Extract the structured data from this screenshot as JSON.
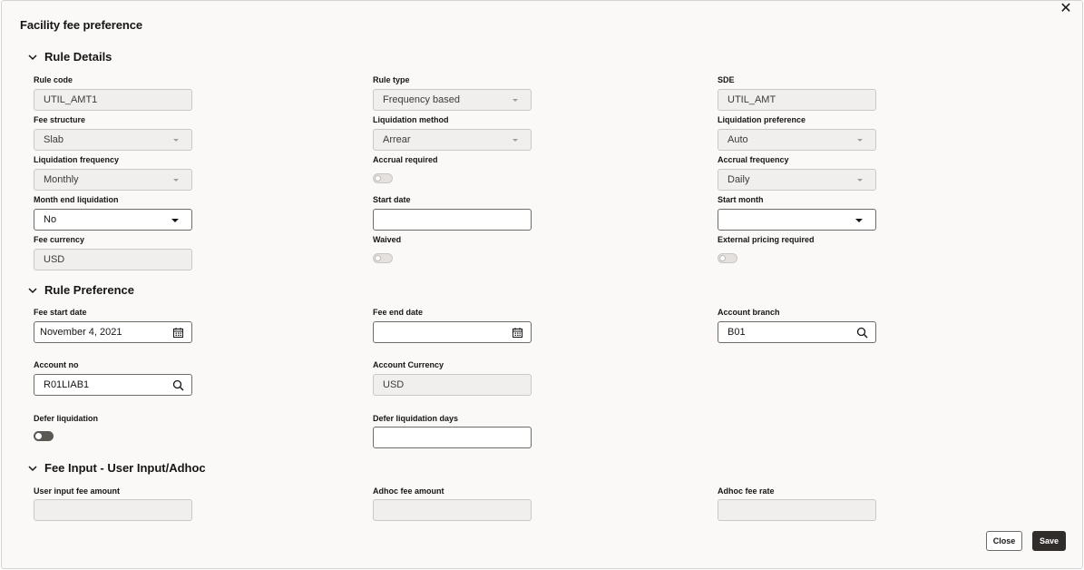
{
  "dialog": {
    "title": "Facility fee preference",
    "close_icon": "close-icon"
  },
  "rule_details": {
    "title": "Rule Details",
    "rule_code": {
      "label": "Rule code",
      "value": "UTIL_AMT1"
    },
    "rule_type": {
      "label": "Rule type",
      "value": "Frequency based"
    },
    "sde": {
      "label": "SDE",
      "value": "UTIL_AMT"
    },
    "fee_structure": {
      "label": "Fee structure",
      "value": "Slab"
    },
    "liquidation_method": {
      "label": "Liquidation method",
      "value": "Arrear"
    },
    "liquidation_preference": {
      "label": "Liquidation preference",
      "value": "Auto"
    },
    "liquidation_frequency": {
      "label": "Liquidation frequency",
      "value": "Monthly"
    },
    "accrual_required": {
      "label": "Accrual required",
      "on": false
    },
    "accrual_frequency": {
      "label": "Accrual frequency",
      "value": "Daily"
    },
    "month_end_liquidation": {
      "label": "Month end liquidation",
      "value": "No"
    },
    "start_date": {
      "label": "Start date",
      "value": ""
    },
    "start_month": {
      "label": "Start month",
      "value": ""
    },
    "fee_currency": {
      "label": "Fee currency",
      "value": "USD"
    },
    "waived": {
      "label": "Waived",
      "on": false
    },
    "external_pricing_required": {
      "label": "External pricing required",
      "on": false
    }
  },
  "rule_preference": {
    "title": "Rule Preference",
    "fee_start_date": {
      "label": "Fee start date",
      "value": "November 4, 2021"
    },
    "fee_end_date": {
      "label": "Fee end date",
      "value": ""
    },
    "account_branch": {
      "label": "Account branch",
      "value": "B01"
    },
    "account_no": {
      "label": "Account no",
      "value": "R01LIAB1"
    },
    "account_currency": {
      "label": "Account Currency",
      "value": "USD"
    },
    "defer_liquidation": {
      "label": "Defer liquidation",
      "on": false
    },
    "defer_liquidation_days": {
      "label": "Defer liquidation days",
      "value": ""
    }
  },
  "fee_input": {
    "title": "Fee Input - User Input/Adhoc",
    "user_input_fee_amount": {
      "label": "User input fee amount",
      "value": ""
    },
    "adhoc_fee_amount": {
      "label": "Adhoc fee amount",
      "value": ""
    },
    "adhoc_fee_rate": {
      "label": "Adhoc fee rate",
      "value": ""
    }
  },
  "footer": {
    "close_label": "Close",
    "save_label": "Save"
  },
  "icons": {
    "section_toggle": "chevron-down-icon",
    "calendar": "calendar-icon",
    "search": "search-icon",
    "dropdown": "caret-down-icon"
  }
}
